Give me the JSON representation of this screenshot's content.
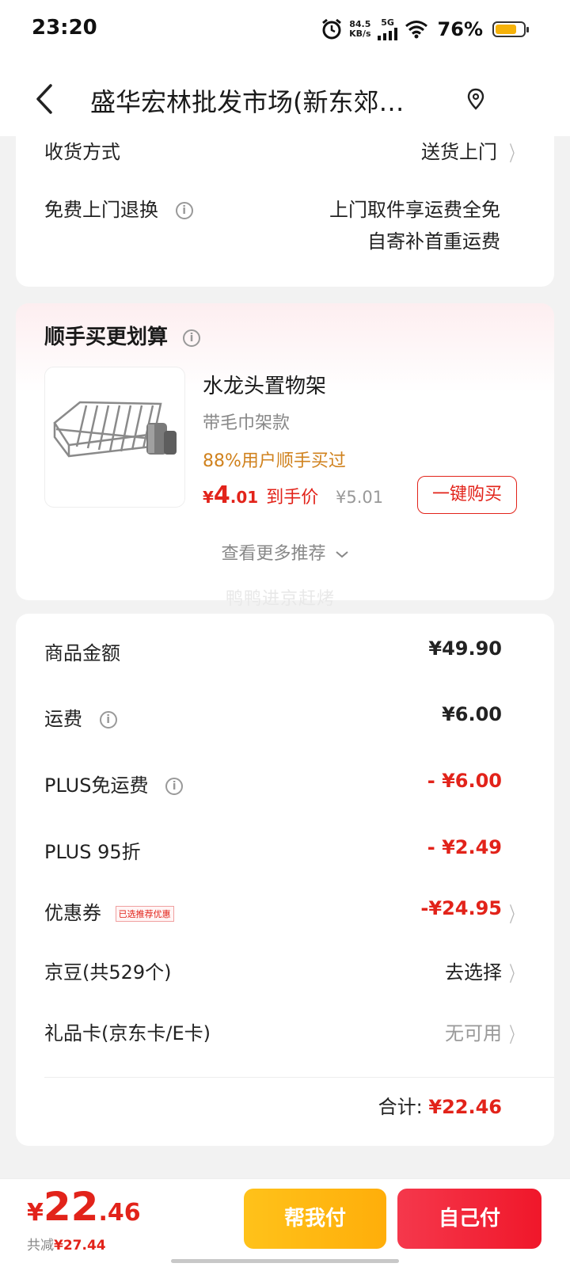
{
  "status": {
    "time": "23:20",
    "net_speed_top": "84.5",
    "net_speed_bottom": "KB/s",
    "signal_label": "5G",
    "battery_pct": "76%",
    "battery_level": 0.76
  },
  "nav": {
    "title": "盛华宏林批发市场(新东郊…"
  },
  "delivery": {
    "method_label": "收货方式",
    "method_value": "送货上门",
    "return_label": "免费上门退换",
    "return_line1": "上门取件享运费全免",
    "return_line2": "自寄补首重运费"
  },
  "reco": {
    "heading": "顺手买更划算",
    "product_name": "水龙头置物架",
    "product_spec": "带毛巾架款",
    "buy_stat": "88%用户顺手买过",
    "price_currency": "¥",
    "price_int": "4",
    "price_dec": ".01",
    "price_tag": "到手价",
    "orig_price": "¥5.01",
    "buy_button": "一键购买",
    "more_link": "查看更多推荐"
  },
  "watermark": "鸭鸭进京赶烤",
  "summary": {
    "goods_label": "商品金额",
    "goods_value": "¥49.90",
    "freight_label": "运费",
    "freight_value": "¥6.00",
    "plus_freight_label": "PLUS免运费",
    "plus_freight_value": "- ¥6.00",
    "plus_discount_label": "PLUS 95折",
    "plus_discount_value": "- ¥2.49",
    "coupon_label": "优惠券",
    "coupon_badge": "已选推荐优惠",
    "coupon_value": "-¥24.95",
    "beans_label": "京豆(共529个)",
    "beans_value": "去选择",
    "giftcard_label": "礼品卡(京东卡/E卡)",
    "giftcard_value": "无可用",
    "total_label": "合计:",
    "total_value": "¥22.46"
  },
  "bottom": {
    "currency": "¥",
    "amount_int": "22",
    "amount_dec": ".46",
    "saved_label": "共减",
    "saved_value": "¥27.44",
    "help_pay": "帮我付",
    "self_pay": "自己付"
  },
  "colors": {
    "accent_red": "#e2231a",
    "orange_text": "#d0821e",
    "help_button": "#ffb812",
    "pay_button": "#f0172a"
  },
  "icons": [
    "alarm-icon",
    "signal-icon",
    "wifi-icon",
    "battery-icon",
    "back-arrow-icon",
    "location-pin-icon",
    "info-icon",
    "chevron-right-icon",
    "chevron-down-icon"
  ]
}
